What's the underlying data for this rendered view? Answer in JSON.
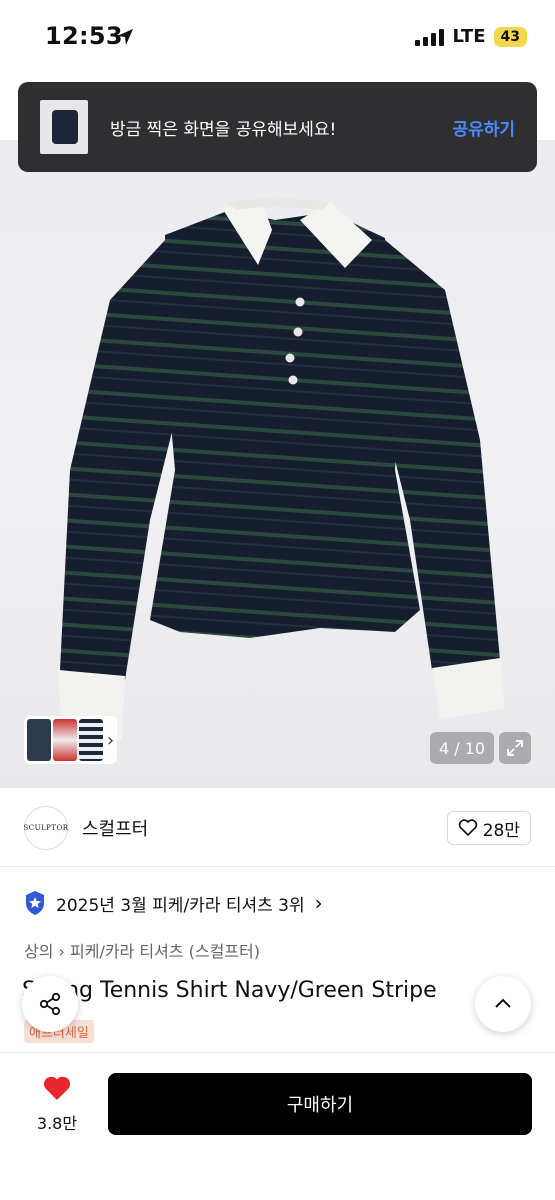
{
  "status_bar": {
    "time": "12:53",
    "network": "LTE",
    "battery": "43"
  },
  "toast": {
    "message": "방금 찍은 화면을 공유해보세요!",
    "action": "공유하기"
  },
  "gallery": {
    "counter": "4 / 10",
    "thumbs_chevron": "›"
  },
  "brand": {
    "logo_text": "SCULPTOR",
    "name": "스컬프터",
    "likes": "28만"
  },
  "ranking": {
    "text": "2025년 3월 피케/카라 티셔츠 3위",
    "chevron": "›"
  },
  "breadcrumb": {
    "text": "상의 › 피케/카라 티셔츠 (스컬프터)"
  },
  "product": {
    "title": "Spring Tennis Shirt Navy/Green Stripe",
    "badge": "애프터세일"
  },
  "bottom_bar": {
    "wish_count": "3.8만",
    "buy_label": "구매하기"
  },
  "colors": {
    "accent_blue": "#4a8bff",
    "heart_red": "#e8262f",
    "toast_bg": "#2f2f31",
    "shirt_navy": "#1a2236",
    "stripe_green": "#2b4a3e"
  },
  "icons": [
    "location-arrow-icon",
    "signal-icon",
    "share-icon",
    "chevron-up-icon",
    "heart-icon",
    "heart-outline-icon",
    "expand-icon",
    "rank-badge-icon"
  ]
}
